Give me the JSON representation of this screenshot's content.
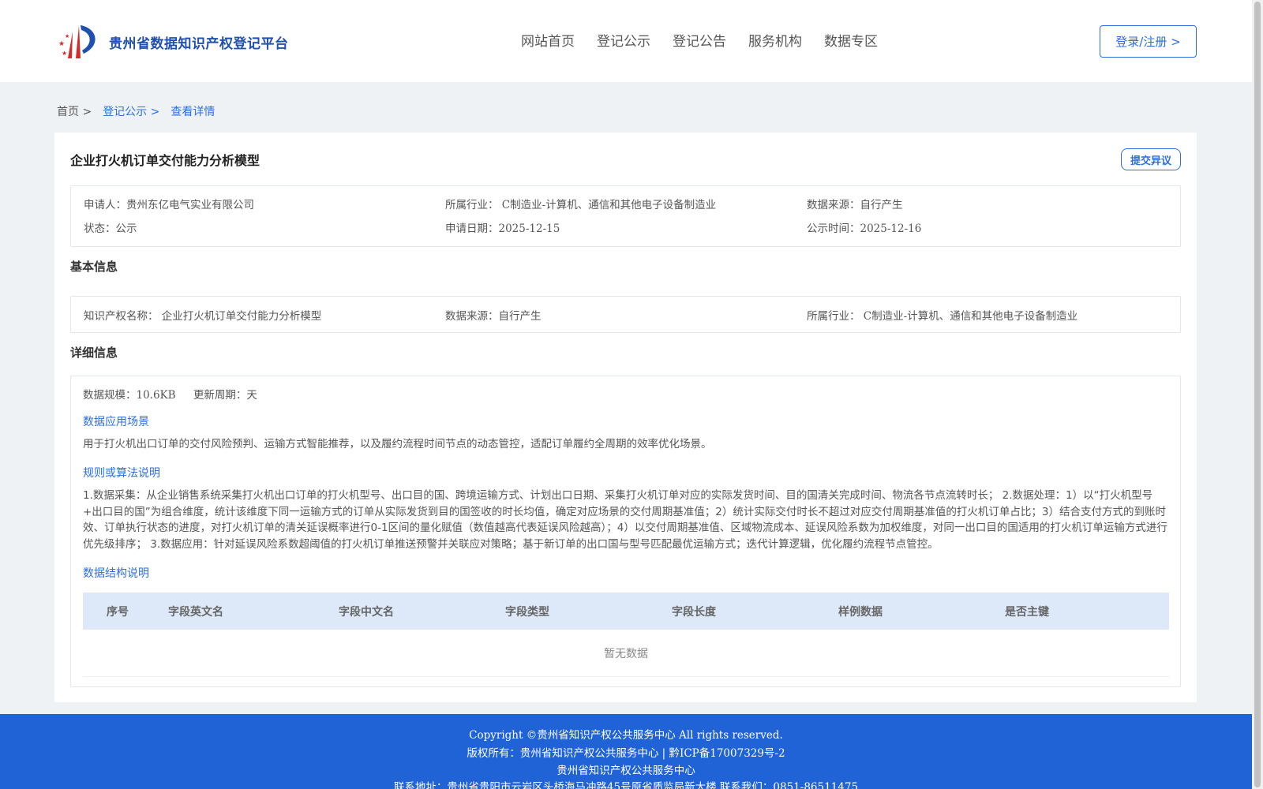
{
  "header": {
    "site_title": "贵州省数据知识产权登记平台",
    "nav": [
      "网站首页",
      "登记公示",
      "登记公告",
      "服务机构",
      "数据专区"
    ],
    "login_label": "登录/注册 >",
    "accent_color": "#2c6ee0"
  },
  "breadcrumb": {
    "home": "首页 >",
    "list": "登记公示 >",
    "current": "查看详情"
  },
  "record": {
    "title": "企业打火机订单交付能力分析模型",
    "objection_label": "提交异议",
    "summary": {
      "applicant_label": "申请人：",
      "applicant": "贵州东亿电气实业有限公司",
      "industry_label": "所属行业：",
      "industry": "C制造业-计算机、通信和其他电子设备制造业",
      "source_label": "数据来源：",
      "source": "自行产生",
      "status_label": "状态：",
      "status": "公示",
      "apply_date_label": "申请日期：",
      "apply_date": "2025-12-15",
      "publish_date_label": "公示时间：",
      "publish_date": "2025-12-16"
    }
  },
  "basic_info": {
    "section_title": "基本信息",
    "ip_name_label": "知识产权名称：",
    "ip_name": "企业打火机订单交付能力分析模型",
    "source_label": "数据来源：",
    "source": "自行产生",
    "industry_label": "所属行业：",
    "industry": "C制造业-计算机、通信和其他电子设备制造业"
  },
  "detail_info": {
    "section_title": "详细信息",
    "scale_label": "数据规模：",
    "scale": "10.6KB",
    "cycle_label": "更新周期：",
    "cycle": "天",
    "scenario_title": "数据应用场景",
    "scenario_text": "用于打火机出口订单的交付风险预判、运输方式智能推荐，以及履约流程时间节点的动态管控，适配订单履约全周期的效率优化场景。",
    "algorithm_title": "规则或算法说明",
    "algorithm_text": "1.数据采集：从企业销售系统采集打火机出口订单的打火机型号、出口目的国、跨境运输方式、计划出口日期、采集打火机订单对应的实际发货时间、目的国清关完成时间、物流各节点流转时长； 2.数据处理：1）以“打火机型号+出口目的国”为组合维度，统计该维度下同一运输方式的订单从实际发货到目的国签收的时长均值，确定对应场景的交付周期基准值；2）统计实际交付时长不超过对应交付周期基准值的打火机订单占比；3）结合支付方式的到账时效、订单执行状态的进度，对打火机订单的清关延误概率进行0-1区间的量化赋值（数值越高代表延误风险越高）；4）以交付周期基准值、区域物流成本、延误风险系数为加权维度，对同一出口目的国适用的打火机订单运输方式进行优先级排序； 3.数据应用：针对延误风险系数超阈值的打火机订单推送预警并关联应对策略；基于新订单的出口国与型号匹配最优运输方式；迭代计算逻辑，优化履约流程节点管控。",
    "structure_title": "数据结构说明",
    "table_headers": [
      "序号",
      "字段英文名",
      "字段中文名",
      "字段类型",
      "字段长度",
      "样例数据",
      "是否主键"
    ],
    "empty_text": "暂无数据"
  },
  "footer": {
    "copyright": "Copyright ©贵州省知识产权公共服务中心 All rights reserved.",
    "owner": "版权所有：贵州省知识产权公共服务中心 | 黔ICP备17007329号-2",
    "org": "贵州省知识产权公共服务中心",
    "contact": "联系地址：贵州省贵阳市云岩区头桥海马冲路45号原省质监局新大楼 联系我们：0851-86511475"
  }
}
